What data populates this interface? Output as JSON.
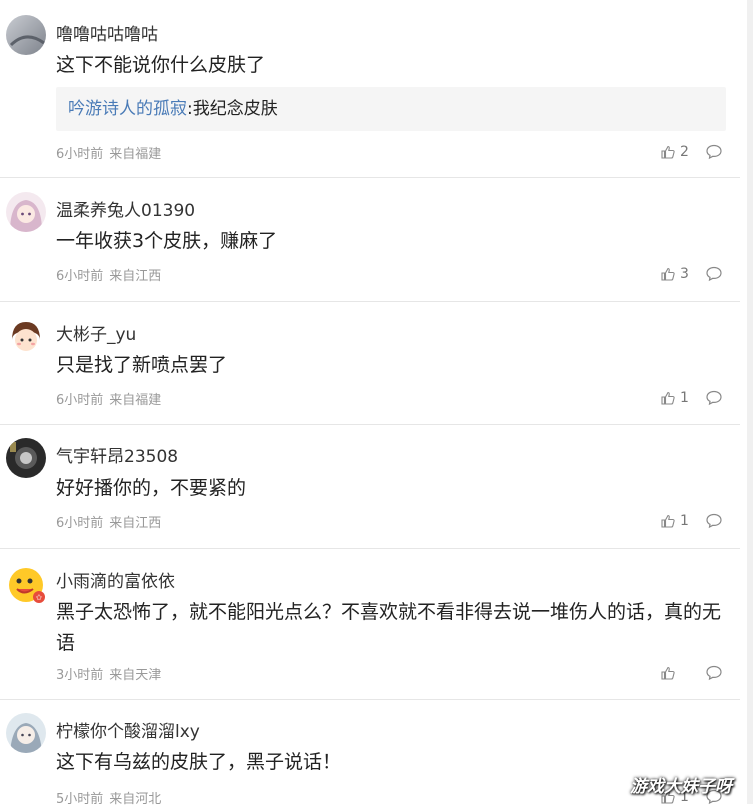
{
  "comments": [
    {
      "user": "噜噜咕咕噜咕",
      "text": "这下不能说你什么皮肤了",
      "quote_user": "吟游诗人的孤寂",
      "quote_text": ":我纪念皮肤",
      "time": "6小时前",
      "location": "来自福建",
      "likes": "2"
    },
    {
      "user": "温柔养兔人01390",
      "text": "一年收获3个皮肤，赚麻了",
      "time": "6小时前",
      "location": "来自江西",
      "likes": "3"
    },
    {
      "user": "大彬子_yu",
      "text": "只是找了新喷点罢了",
      "time": "6小时前",
      "location": "来自福建",
      "likes": "1"
    },
    {
      "user": "气宇轩昂23508",
      "text": "好好播你的，不要紧的",
      "time": "6小时前",
      "location": "来自江西",
      "likes": "1"
    },
    {
      "user": "小雨滴的富依依",
      "text": "黑子太恐怖了，就不能阳光点么？不喜欢就不看非得去说一堆伤人的话，真的无语",
      "time": "3小时前",
      "location": "来自天津",
      "likes": ""
    },
    {
      "user": "柠檬你个酸溜溜lxy",
      "text": "这下有乌兹的皮肤了，黑子说话！",
      "time": "5小时前",
      "location": "来自河北",
      "likes": "1"
    }
  ],
  "watermark": "游戏大妹子呀",
  "icons": {
    "like": "thumbs-up-icon",
    "reply": "comment-bubble-icon"
  },
  "colors": {
    "link": "#4a7bb7",
    "meta": "#999999",
    "quote_bg": "#f5f5f5"
  }
}
